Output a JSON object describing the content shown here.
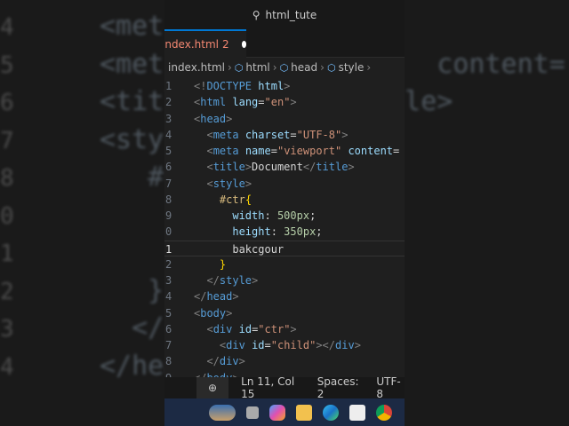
{
  "background_code": [
    {
      "num": "4",
      "text": "<met"
    },
    {
      "num": "5",
      "text": "<met              \"  content="
    },
    {
      "num": "6",
      "text": "<titl             tle>"
    },
    {
      "num": "7",
      "text": "<sty"
    },
    {
      "num": "8",
      "text": "   #c"
    },
    {
      "num": "0",
      "text": ""
    },
    {
      "num": "1",
      "text": ""
    },
    {
      "num": "2",
      "text": "   }"
    },
    {
      "num": "3",
      "text": "  </st"
    },
    {
      "num": "4",
      "text": "</head"
    }
  ],
  "titlebar": {
    "search": "html_tute"
  },
  "tab": {
    "label": "index.html",
    "problems": "2"
  },
  "breadcrumb": [
    "index.html",
    "html",
    "head",
    "style"
  ],
  "lines": [
    {
      "n": "1",
      "html": "<span class='p'>&lt;!</span><span class='t'>DOCTYPE</span> <span class='a'>html</span><span class='p'>&gt;</span>"
    },
    {
      "n": "2",
      "html": "<span class='p'>&lt;</span><span class='t'>html</span> <span class='a'>lang</span><span class='w'>=</span><span class='s'>\"en\"</span><span class='p'>&gt;</span>"
    },
    {
      "n": "3",
      "html": "<span class='p'>&lt;</span><span class='t'>head</span><span class='p'>&gt;</span>"
    },
    {
      "n": "4",
      "html": "  <span class='p'>&lt;</span><span class='t'>meta</span> <span class='a'>charset</span><span class='w'>=</span><span class='s'>\"UTF-8\"</span><span class='p'>&gt;</span>"
    },
    {
      "n": "5",
      "html": "  <span class='p'>&lt;</span><span class='t'>meta</span> <span class='a'>name</span><span class='w'>=</span><span class='s'>\"viewport\"</span> <span class='a'>content</span><span class='w'>=</span>"
    },
    {
      "n": "6",
      "html": "  <span class='p'>&lt;</span><span class='t'>title</span><span class='p'>&gt;</span><span class='w'>Document</span><span class='p'>&lt;/</span><span class='t'>title</span><span class='p'>&gt;</span>"
    },
    {
      "n": "7",
      "html": "  <span class='p'>&lt;</span><span class='t'>style</span><span class='p'>&gt;</span>"
    },
    {
      "n": "8",
      "html": "    <span class='sel'>#ctr</span><span class='br'>{</span>"
    },
    {
      "n": "9",
      "html": "      <span class='a'>width</span><span class='w'>: </span><span class='n'>500px</span><span class='w'>;</span>"
    },
    {
      "n": "0",
      "html": "      <span class='a'>height</span><span class='w'>: </span><span class='n'>350px</span><span class='w'>;</span>"
    },
    {
      "n": "1",
      "html": "      <span class='w'>bakcgour</span>",
      "cur": true
    },
    {
      "n": "2",
      "html": "    <span class='br'>}</span>"
    },
    {
      "n": "3",
      "html": "  <span class='p'>&lt;/</span><span class='t'>style</span><span class='p'>&gt;</span>"
    },
    {
      "n": "4",
      "html": "<span class='p'>&lt;/</span><span class='t'>head</span><span class='p'>&gt;</span>"
    },
    {
      "n": "5",
      "html": "<span class='p'>&lt;</span><span class='t'>body</span><span class='p'>&gt;</span>"
    },
    {
      "n": "6",
      "html": "  <span class='p'>&lt;</span><span class='t'>div</span> <span class='a'>id</span><span class='w'>=</span><span class='s'>\"ctr\"</span><span class='p'>&gt;</span>"
    },
    {
      "n": "7",
      "html": "    <span class='p'>&lt;</span><span class='t'>div</span> <span class='a'>id</span><span class='w'>=</span><span class='s'>\"child\"</span><span class='p'>&gt;&lt;/</span><span class='t'>div</span><span class='p'>&gt;</span>"
    },
    {
      "n": "8",
      "html": "  <span class='p'>&lt;/</span><span class='t'>div</span><span class='p'>&gt;</span>"
    },
    {
      "n": "9",
      "html": "<span class='p'>&lt;/</span><span class='t'>body</span><span class='p'>&gt;</span>"
    }
  ],
  "status": {
    "position": "Ln 11, Col 15",
    "spaces": "Spaces: 2",
    "encoding": "UTF-8"
  },
  "taskbar": [
    "widgets",
    "task-view",
    "copilot",
    "file-explorer",
    "edge",
    "store",
    "chrome"
  ]
}
